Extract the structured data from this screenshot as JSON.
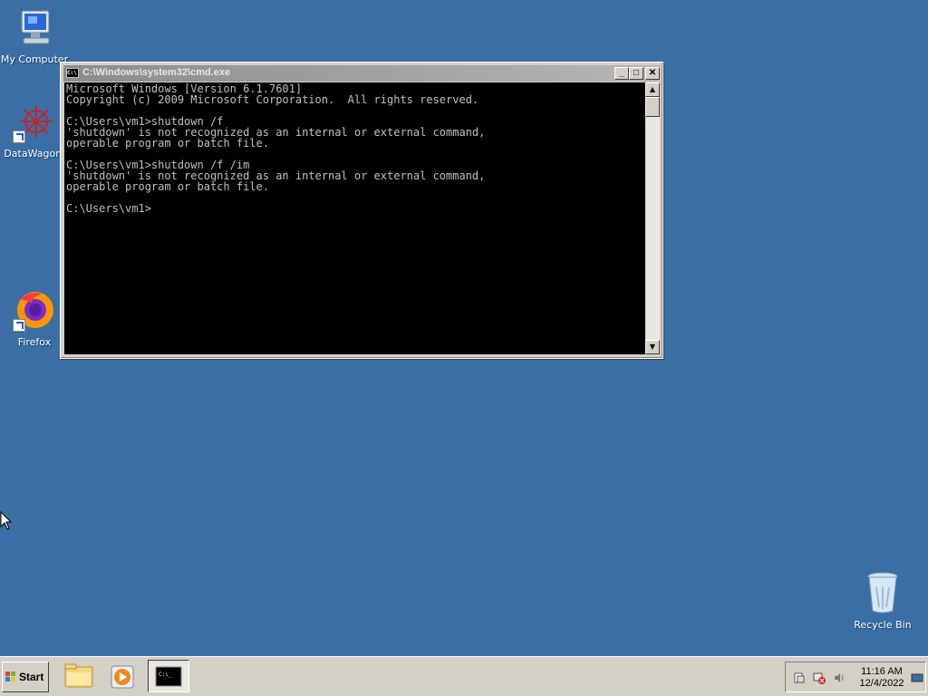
{
  "desktop": {
    "icons": [
      {
        "label": "My Computer"
      },
      {
        "label": "DataWagon."
      },
      {
        "label": "Firefox"
      },
      {
        "label": "Recycle Bin"
      }
    ]
  },
  "window": {
    "title": "C:\\Windows\\system32\\cmd.exe",
    "icon_text": "C:\\",
    "minimize": "_",
    "maximize": "□",
    "close": "✕",
    "console_lines": [
      "Microsoft Windows [Version 6.1.7601]",
      "Copyright (c) 2009 Microsoft Corporation.  All rights reserved.",
      "",
      "C:\\Users\\vm1>shutdown /f",
      "'shutdown' is not recognized as an internal or external command,",
      "operable program or batch file.",
      "",
      "C:\\Users\\vm1>shutdown /f /im",
      "'shutdown' is not recognized as an internal or external command,",
      "operable program or batch file.",
      "",
      "C:\\Users\\vm1>"
    ]
  },
  "taskbar": {
    "start_label": "Start",
    "cmd_icon_text": "C:\\_",
    "clock_time": "11:16 AM",
    "clock_date": "12/4/2022"
  },
  "colors": {
    "desktop": "#3a6ea5",
    "console_bg": "#000000",
    "console_fg": "#c0c0c0"
  }
}
